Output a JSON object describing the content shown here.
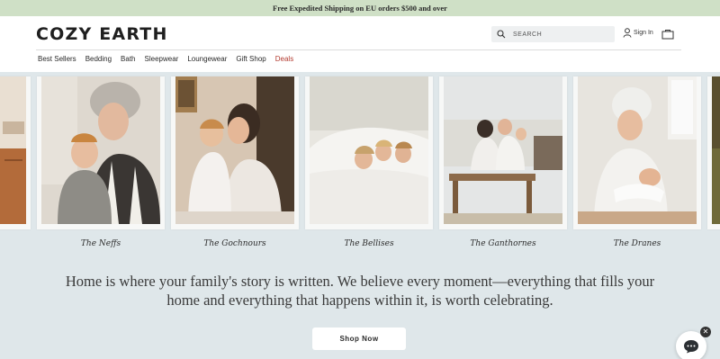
{
  "promo_bar": {
    "text": "Free Expedited Shipping on EU orders $500 and over"
  },
  "header": {
    "logo": "COZY EARTH",
    "search_placeholder": "SEARCH",
    "sign_in": "Sign In",
    "icons": [
      "search-icon",
      "user-icon",
      "bag-icon"
    ]
  },
  "nav": {
    "items": [
      "Best Sellers",
      "Bedding",
      "Bath",
      "Sleepwear",
      "Loungewear",
      "Gift Shop",
      "Deals"
    ],
    "deal_color": "#b23a2f"
  },
  "families": [
    {
      "caption": "The Neffs"
    },
    {
      "caption": "The Gochnours"
    },
    {
      "caption": "The Bellises"
    },
    {
      "caption": "The Ganthornes"
    },
    {
      "caption": "The Dranes"
    }
  ],
  "tagline": "Home is where your family's story is written. We believe every moment—everything that fills your home and everything that happens within it, is worth celebrating.",
  "cta": {
    "label": "Shop Now"
  },
  "colors": {
    "promo": "#cfe0c6",
    "background": "#dfe7ea"
  }
}
